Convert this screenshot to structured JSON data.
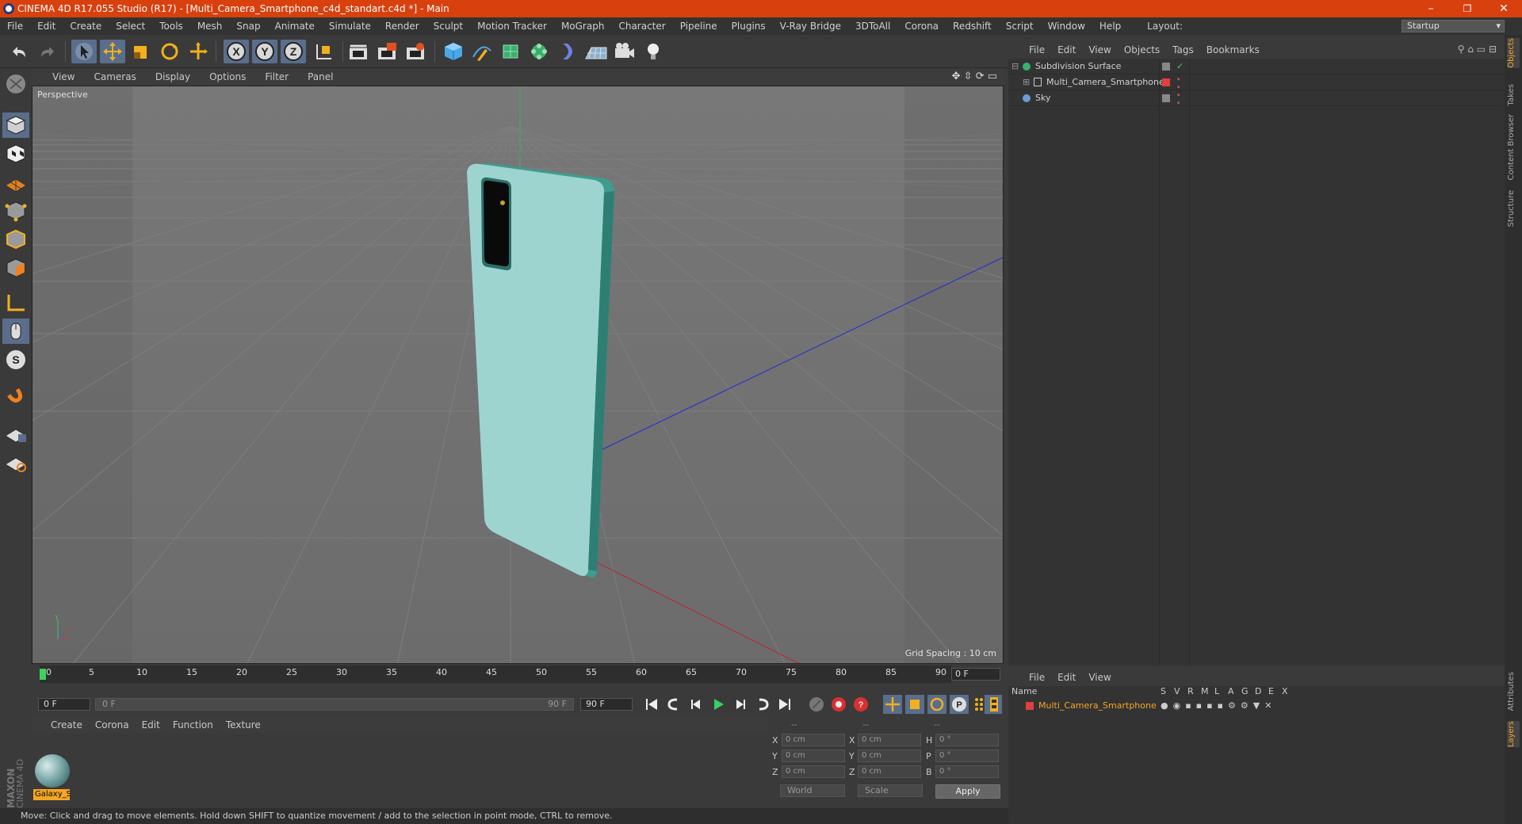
{
  "window": {
    "title": "CINEMA 4D R17.055 Studio (R17) - [Multi_Camera_Smartphone_c4d_standart.c4d *] - Main",
    "minimize": "–",
    "maximize": "❐",
    "close": "✕"
  },
  "menu": [
    "File",
    "Edit",
    "Create",
    "Select",
    "Tools",
    "Mesh",
    "Snap",
    "Animate",
    "Simulate",
    "Render",
    "Sculpt",
    "Motion Tracker",
    "MoGraph",
    "Character",
    "Pipeline",
    "Plugins",
    "V-Ray Bridge",
    "3DToAll",
    "Corona",
    "Redshift",
    "Script",
    "Window",
    "Help"
  ],
  "layout": {
    "label": "Layout:",
    "value": "Startup"
  },
  "viewport": {
    "menu": [
      "View",
      "Cameras",
      "Display",
      "Options",
      "Filter",
      "Panel"
    ],
    "camera_label": "Perspective",
    "grid_spacing": "Grid Spacing : 10 cm",
    "axis_y": "Y",
    "axis_z": "Z"
  },
  "timeline": {
    "ticks": [
      "0",
      "5",
      "10",
      "15",
      "20",
      "25",
      "30",
      "35",
      "40",
      "45",
      "50",
      "55",
      "60",
      "65",
      "70",
      "75",
      "80",
      "85",
      "90"
    ],
    "current_frame": "0 F",
    "start_field": "0 F",
    "range_start": "0 F",
    "range_end": "90 F",
    "end_field": "90 F"
  },
  "material_panel": {
    "menu": [
      "Create",
      "Corona",
      "Edit",
      "Function",
      "Texture"
    ],
    "material_name": "Galaxy_S"
  },
  "coordinates": {
    "header": [
      "--",
      "--",
      "--"
    ],
    "rows": [
      {
        "a": "X",
        "v1": "0 cm",
        "b": "X",
        "v2": "0 cm",
        "c": "H",
        "v3": "0 °"
      },
      {
        "a": "Y",
        "v1": "0 cm",
        "b": "Y",
        "v2": "0 cm",
        "c": "P",
        "v3": "0 °"
      },
      {
        "a": "Z",
        "v1": "0 cm",
        "b": "Z",
        "v2": "0 cm",
        "c": "B",
        "v3": "0 °"
      }
    ],
    "mode": "World",
    "scale": "Scale",
    "apply": "Apply"
  },
  "object_manager": {
    "menu": [
      "File",
      "Edit",
      "View",
      "Objects",
      "Tags",
      "Bookmarks"
    ],
    "objects": [
      "Subdivision Surface",
      "Multi_Camera_Smartphone",
      "Sky"
    ]
  },
  "layer_manager": {
    "menu": [
      "File",
      "Edit",
      "View"
    ],
    "columns": [
      "Name",
      "S",
      "V",
      "R",
      "M",
      "L",
      "A",
      "G",
      "D",
      "E",
      "X"
    ],
    "layers": [
      "Multi_Camera_Smartphone"
    ]
  },
  "right_tabs": [
    "Objects",
    "Takes",
    "Content Browser",
    "Structure",
    "Attributes",
    "Layers"
  ],
  "status": "Move: Click and drag to move elements. Hold down SHIFT to quantize movement / add to the selection in point mode, CTRL to remove.",
  "brand": {
    "line1": "MAXON",
    "line2": "CINEMA 4D"
  },
  "colors": {
    "title_bar": "#d8400e",
    "phone_body": "#9ed4cf",
    "phone_edge": "#3f9c8e",
    "layer_color": "#e0403a",
    "accent": "#f5a623"
  }
}
